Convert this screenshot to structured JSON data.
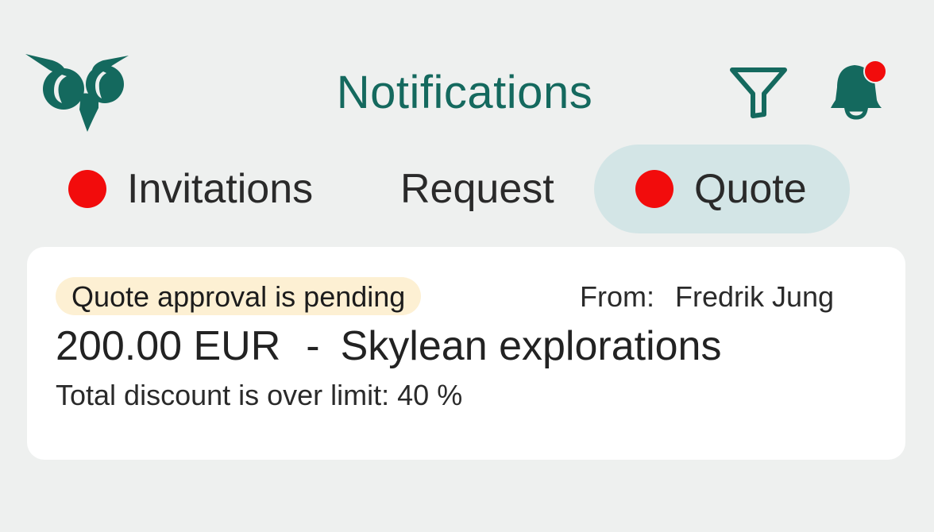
{
  "header": {
    "title": "Notifications",
    "logo_icon": "owl-logo-icon",
    "filter_icon": "filter-icon",
    "bell_icon": "bell-icon",
    "bell_has_unread": true
  },
  "tabs": [
    {
      "label": "Invitations",
      "has_dot": true,
      "active": false
    },
    {
      "label": "Request",
      "has_dot": false,
      "active": false
    },
    {
      "label": "Quote",
      "has_dot": true,
      "active": true
    }
  ],
  "notification": {
    "status": "Quote approval is pending",
    "from_label": "From:",
    "from_name": "Fredrik Jung",
    "amount": "200.00 EUR",
    "separator": "-",
    "project": "Skylean explorations",
    "detail": "Total discount is over limit: 40 %"
  },
  "colors": {
    "brand": "#14695e",
    "unread_dot": "#f20c0c",
    "active_tab_bg": "#d3e5e6",
    "badge_bg": "#fdf0d3",
    "page_bg": "#eef0ef"
  }
}
